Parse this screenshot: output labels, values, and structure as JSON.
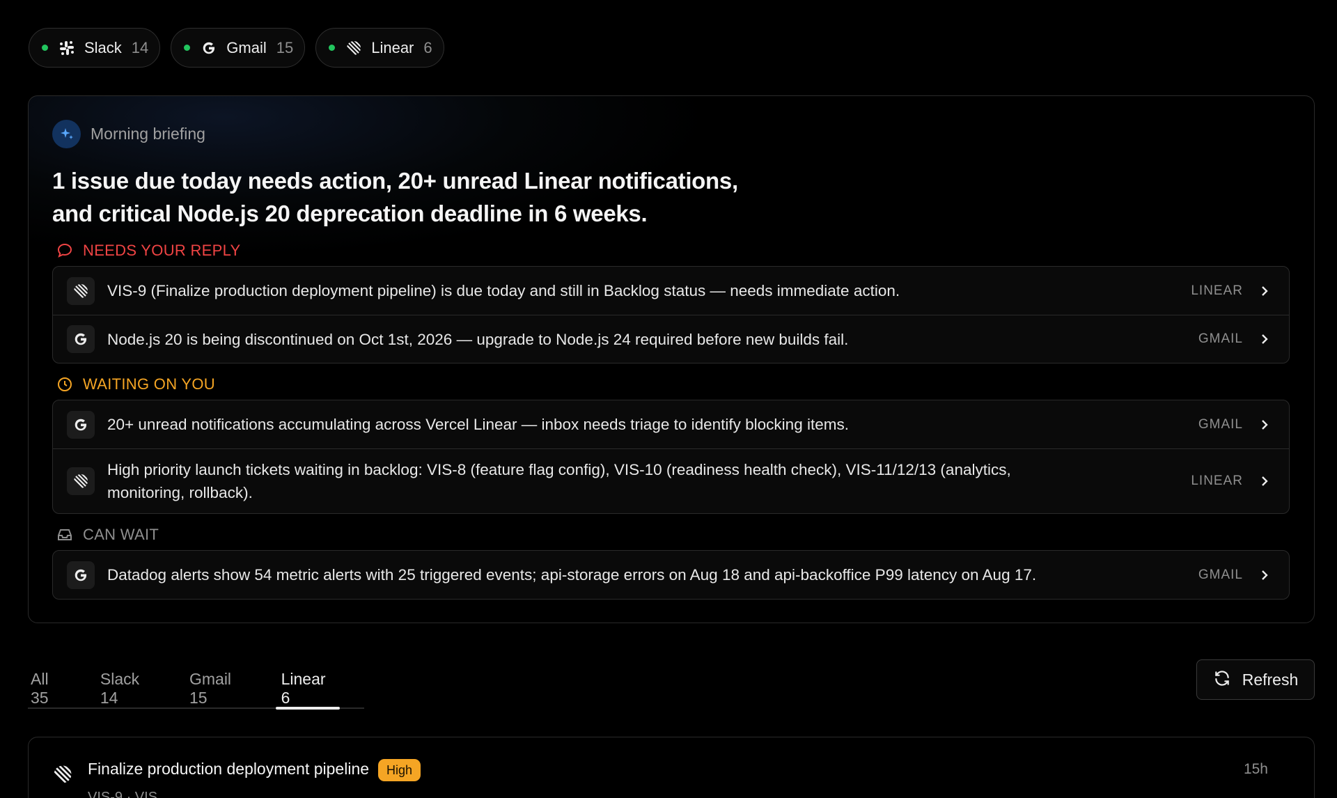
{
  "sources": [
    {
      "name": "Slack",
      "count": "14",
      "icon": "slack-icon"
    },
    {
      "name": "Gmail",
      "count": "15",
      "icon": "gmail-icon"
    },
    {
      "name": "Linear",
      "count": "6",
      "icon": "linear-icon"
    }
  ],
  "briefing": {
    "label": "Morning briefing",
    "headline_line1": "1 issue due today needs action, 20+ unread Linear notifications,",
    "headline_line2": "and critical Node.js 20 deprecation deadline in 6 weeks.",
    "sections": {
      "reply": {
        "label": "NEEDS YOUR REPLY",
        "color": "#f04444",
        "items": [
          {
            "text": "VIS-9 (Finalize production deployment pipeline) is due today and still in Backlog status — needs immediate action.",
            "source": "LINEAR"
          },
          {
            "text": "Node.js 20 is being discontinued on Oct 1st, 2026 — upgrade to Node.js 24 required before new builds fail.",
            "source": "GMAIL"
          }
        ]
      },
      "waiting": {
        "label": "WAITING ON YOU",
        "color": "#f5a524",
        "items": [
          {
            "text": "20+ unread notifications accumulating across Vercel Linear — inbox needs triage to identify blocking items.",
            "source": "GMAIL"
          },
          {
            "text": "High priority launch tickets waiting in backlog: VIS-8 (feature flag config), VIS-10 (readiness health check), VIS-11/12/13 (analytics, monitoring, rollback).",
            "source": "LINEAR"
          }
        ]
      },
      "can_wait": {
        "label": "CAN WAIT",
        "color": "#8f8f8f",
        "items": [
          {
            "text": "Datadog alerts show 54 metric alerts with 25 triggered events; api-storage errors on Aug 18 and api-backoffice P99 latency on Aug 17.",
            "source": "GMAIL"
          }
        ]
      }
    }
  },
  "tabs": [
    {
      "label": "All 35",
      "active": false
    },
    {
      "label": "Slack 14",
      "active": false
    },
    {
      "label": "Gmail 15",
      "active": false
    },
    {
      "label": "Linear 6",
      "active": true
    }
  ],
  "refresh_label": "Refresh",
  "issue": {
    "title": "Finalize production deployment pipeline",
    "priority": "High",
    "subtitle": "VIS-9 · VIS",
    "time": "15h"
  }
}
